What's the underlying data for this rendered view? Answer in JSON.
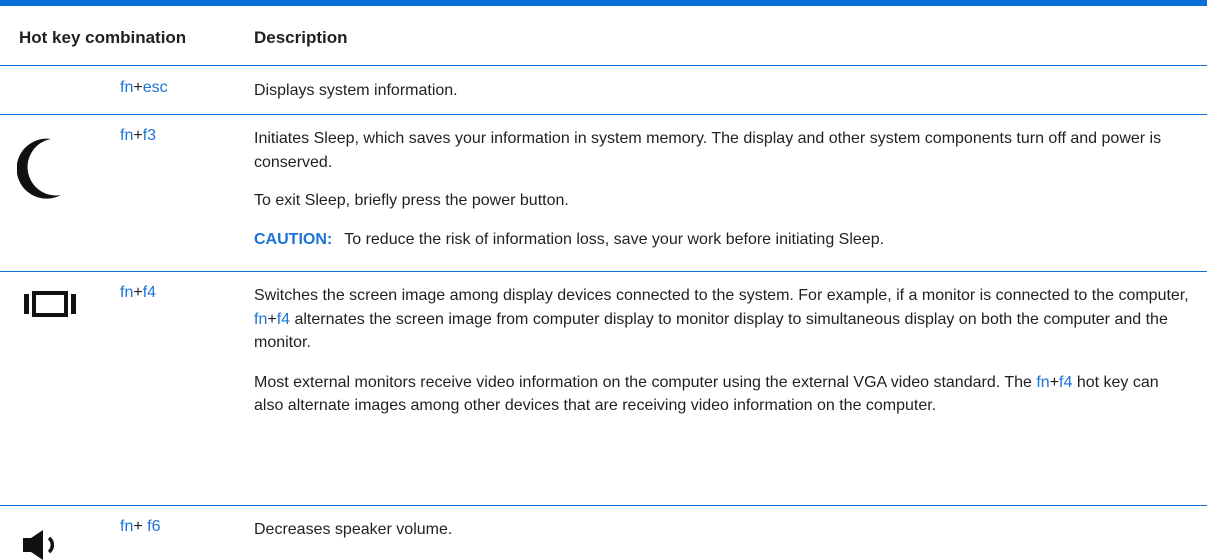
{
  "table": {
    "headers": {
      "combo": "Hot key combination",
      "description": "Description"
    },
    "rows": [
      {
        "icon": "",
        "key": {
          "fn": "fn",
          "plus": "+",
          "key": "esc"
        },
        "paragraphs": [
          "Displays system information."
        ]
      },
      {
        "icon": "moon-icon",
        "key": {
          "fn": "fn",
          "plus": "+",
          "key": "f3"
        },
        "paragraphs": [
          "Initiates Sleep, which saves your information in system memory. The display and other system components turn off and power is conserved.",
          "To exit Sleep, briefly press the power button."
        ],
        "caution": {
          "label": "CAUTION:",
          "text": "To reduce the risk of information loss, save your work before initiating Sleep."
        }
      },
      {
        "icon": "display-switch-icon",
        "key": {
          "fn": "fn",
          "plus": "+",
          "key": "f4"
        },
        "p1": {
          "before": "Switches the screen image among display devices connected to the system. For example, if a monitor is connected to the computer, ",
          "fn": "fn",
          "plus": "+",
          "key": "f4",
          "after": " alternates the screen image from computer display to monitor display to simultaneous display on both the computer and the monitor."
        },
        "p2": {
          "before": "Most external monitors receive video information on the computer using the external VGA video standard. The ",
          "fn": "fn",
          "plus": "+",
          "key": "f4",
          "after": " hot key can also alternate images among other devices that are receiving video information on the computer."
        }
      },
      {
        "icon": "speaker-volume-down-icon",
        "key": {
          "fn": "fn",
          "plus": "+ ",
          "key": "f6"
        },
        "paragraphs": [
          "Decreases speaker volume."
        ]
      }
    ]
  },
  "colors": {
    "accent": "#0a6fd6",
    "link": "#1a73d8",
    "text": "#231f20"
  }
}
